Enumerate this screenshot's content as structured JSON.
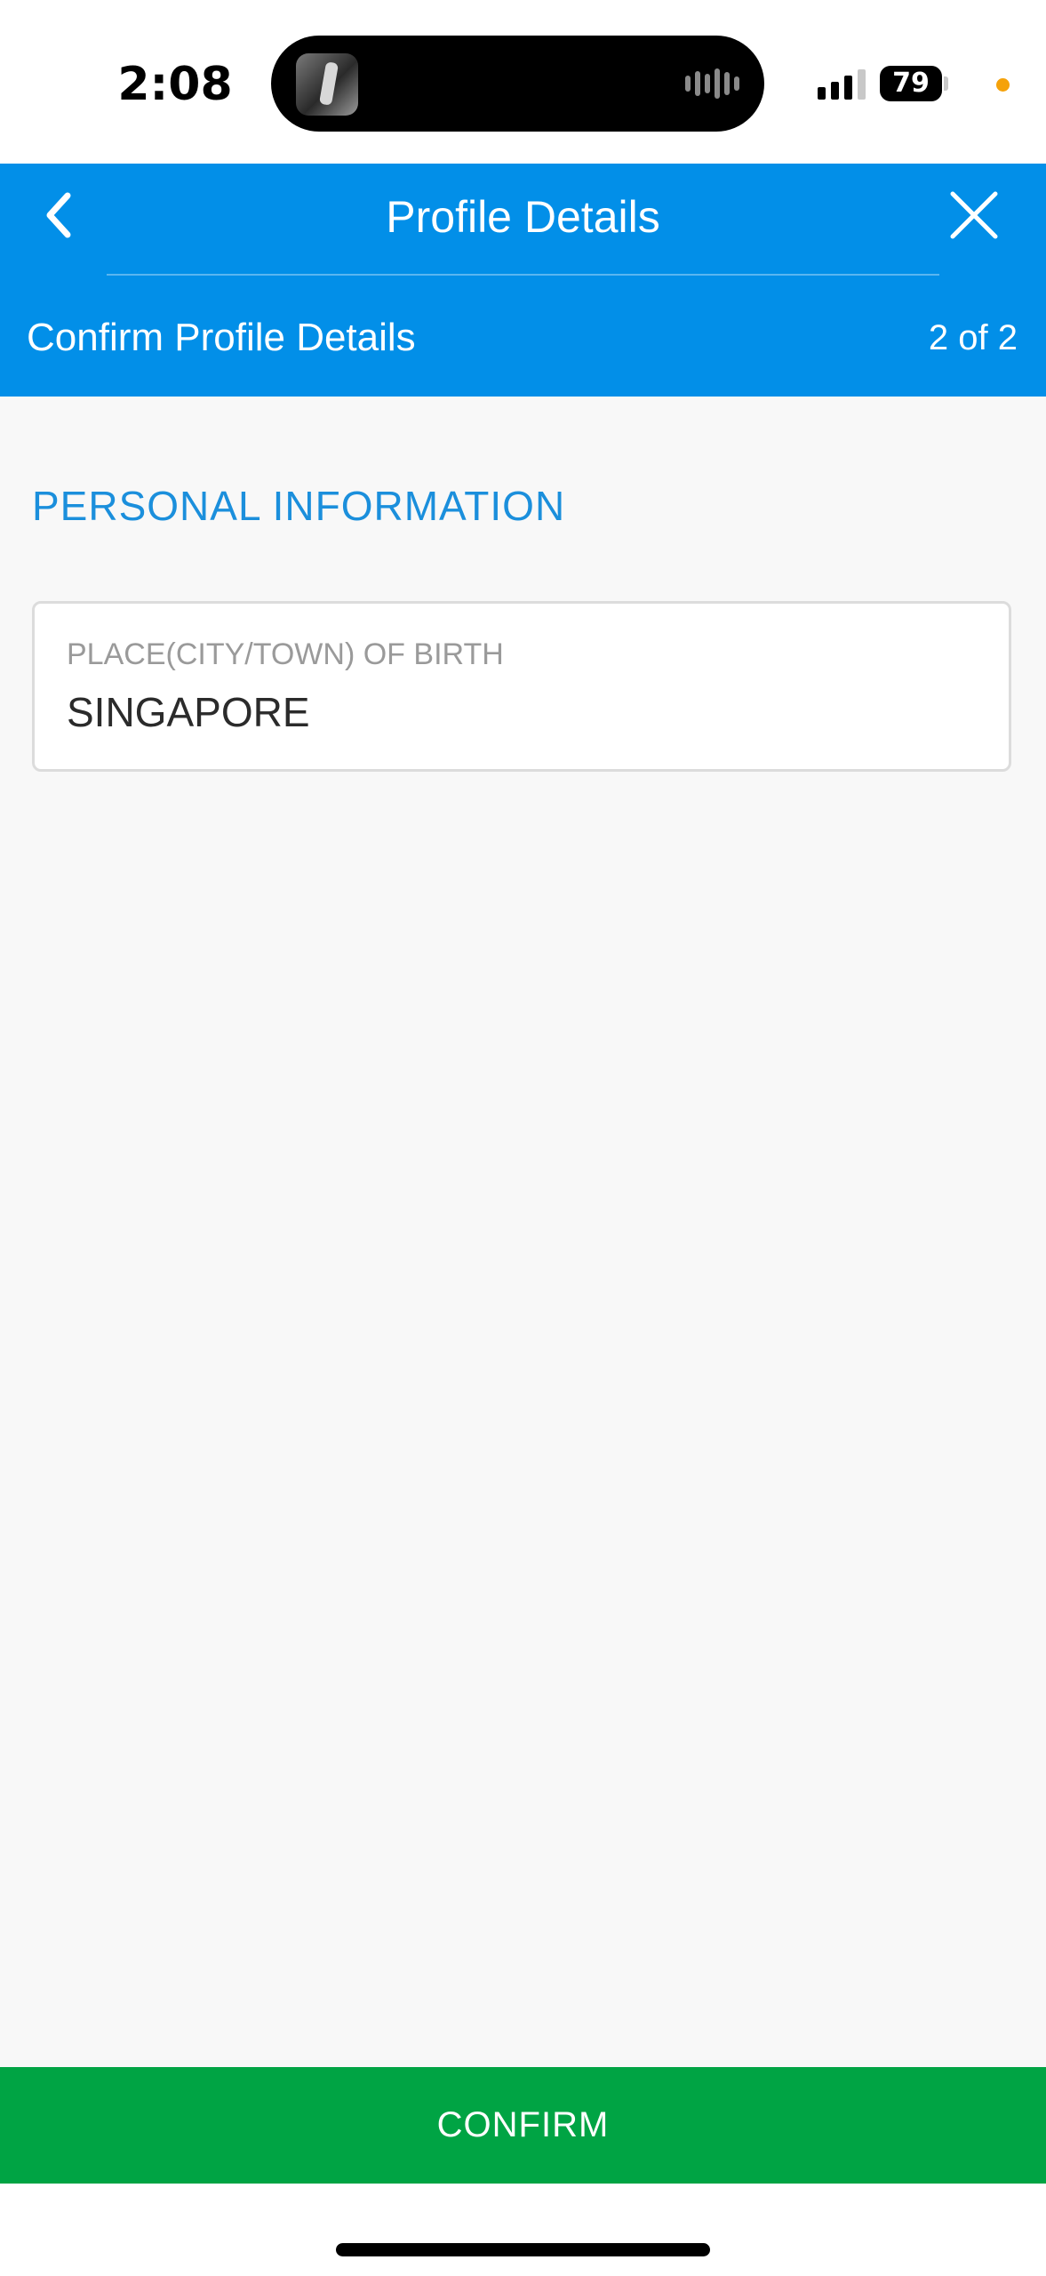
{
  "status_bar": {
    "time": "2:08",
    "battery_level": "79",
    "signal_bars_active": 3,
    "signal_bars_total": 4,
    "privacy_indicator_color": "#f5a20a"
  },
  "header": {
    "back_icon": "chevron-left-icon",
    "title": "Profile Details",
    "close_icon": "close-icon",
    "subtitle": "Confirm Profile Details",
    "step": "2 of 2",
    "background_color": "#028fe8"
  },
  "section": {
    "title": "PERSONAL INFORMATION",
    "color": "#1b8fdc"
  },
  "fields": [
    {
      "label": "PLACE(CITY/TOWN) OF BIRTH",
      "value": "SINGAPORE"
    }
  ],
  "footer": {
    "confirm_label": "CONFIRM",
    "button_color": "#00a444"
  }
}
